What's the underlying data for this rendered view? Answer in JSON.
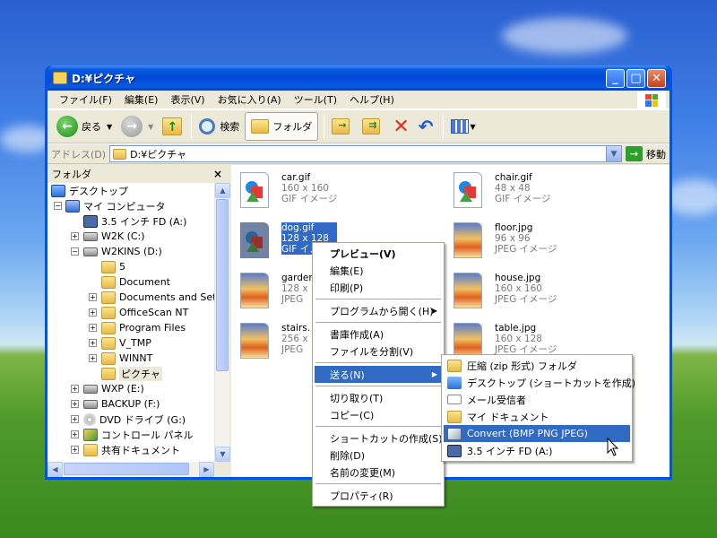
{
  "window": {
    "title": "D:¥ピクチャ"
  },
  "menubar": [
    {
      "label": "ファイル(F)"
    },
    {
      "label": "編集(E)"
    },
    {
      "label": "表示(V)"
    },
    {
      "label": "お気に入り(A)"
    },
    {
      "label": "ツール(T)"
    },
    {
      "label": "ヘルプ(H)"
    }
  ],
  "toolbar": {
    "back_label": "戻る",
    "search_label": "検索",
    "folders_label": "フォルダ"
  },
  "address": {
    "label": "アドレス(D)",
    "value": "D:¥ピクチャ",
    "go_label": "移動"
  },
  "folder_pane": {
    "title": "フォルダ",
    "close": "×",
    "tree": [
      {
        "label": "デスクトップ"
      },
      {
        "label": "マイ コンピュータ"
      },
      {
        "label": "3.5 インチ FD (A:)"
      },
      {
        "label": "W2K (C:)"
      },
      {
        "label": "W2KINS (D:)"
      },
      {
        "label": "5"
      },
      {
        "label": "Document"
      },
      {
        "label": "Documents and Setti"
      },
      {
        "label": "OfficeScan NT"
      },
      {
        "label": "Program Files"
      },
      {
        "label": "V_TMP"
      },
      {
        "label": "WINNT"
      },
      {
        "label": "ピクチャ"
      },
      {
        "label": "WXP (E:)"
      },
      {
        "label": "BACKUP (F:)"
      },
      {
        "label": "DVD ドライブ (G:)"
      },
      {
        "label": "コントロール パネル"
      },
      {
        "label": "共有ドキュメント"
      }
    ]
  },
  "files": [
    {
      "name": "car.gif",
      "dims": "160 x 160",
      "type": "GIF イメージ"
    },
    {
      "name": "chair.gif",
      "dims": "48 x 48",
      "type": "GIF イメージ"
    },
    {
      "name": "dog.gif",
      "dims": "128 x 128",
      "type": "GIF イメージ"
    },
    {
      "name": "floor.jpg",
      "dims": "96 x 96",
      "type": "JPEG イメージ"
    },
    {
      "name": "garden",
      "dims": "128 x",
      "type": "JPEG"
    },
    {
      "name": "house.jpg",
      "dims": "160 x 160",
      "type": "JPEG イメージ"
    },
    {
      "name": "stairs.",
      "dims": "256 x",
      "type": "JPEG"
    },
    {
      "name": "table.jpg",
      "dims": "160 x 128",
      "type": "JPEG イメージ"
    }
  ],
  "context_menu": {
    "items": [
      "プレビュー(V)",
      "編集(E)",
      "印刷(P)",
      "プログラムから開く(H)",
      "書庫作成(A)",
      "ファイルを分割(V)",
      "送る(N)",
      "切り取り(T)",
      "コピー(C)",
      "ショートカットの作成(S)",
      "削除(D)",
      "名前の変更(M)",
      "プロパティ(R)"
    ]
  },
  "send_to_menu": {
    "items": [
      "圧縮 (zip 形式) フォルダ",
      "デスクトップ (ショートカットを作成)",
      "メール受信者",
      "マイ ドキュメント",
      "Convert (BMP PNG JPEG)",
      "3.5 インチ FD (A:)"
    ]
  }
}
